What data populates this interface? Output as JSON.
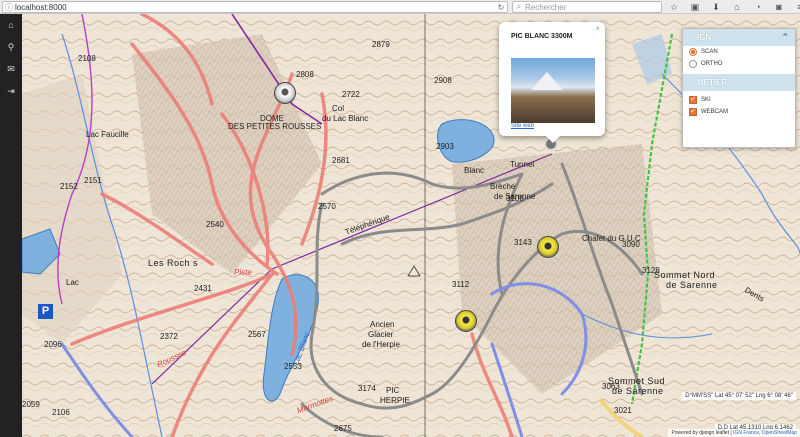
{
  "browser": {
    "url": "localhost:8000",
    "search_placeholder": "Rechercher"
  },
  "sidenav": {
    "items": [
      "home-icon",
      "search-icon",
      "mail-icon",
      "logout-icon"
    ]
  },
  "map_labels": {
    "dome": "DOME",
    "petites_rousses": "DES PETITES ROUSSES",
    "col_lac_blanc": "Col",
    "du_lac_blanc": "du Lac Blanc",
    "tunnel": "Tunnel",
    "breche": "Brèche",
    "de_sarenne": "de Sarenne",
    "chalet": "Chalet du G.U.C",
    "sommet_nord": "Sommet Nord",
    "de_sarenne_2": "de Sarenne",
    "sommet_sud": "Sommet Sud",
    "de_sarenne_3": "de Sarenne",
    "les_rochers": "Les Roch s",
    "lac_blanc": "Lac Blanc",
    "ancien": "Ancien",
    "glacier": "Glacier",
    "de_lhorpie": "de l'Herpie",
    "pic": "PIC",
    "herpie": "HERPIE",
    "teleph": "Téléphérique",
    "lac_faucille": "Lac Faucille",
    "rousses": "Rousses",
    "marmottes": "Marmottes",
    "blanc": "Blanc",
    "dents": "Dents",
    "piste": "Piste",
    "lac": "Lac",
    "e2808": "2808",
    "e2722": "2722",
    "e2879": "2879",
    "e2908": "2908",
    "e2903": "2903",
    "e2681": "2681",
    "e2570": "2570",
    "e3106": "3106",
    "e3143": "3143",
    "e3090": "3090",
    "e3128": "3128",
    "e2540": "2540",
    "e2431": "2431",
    "e2567": "2567",
    "e2372": "2372",
    "e2553": "2553",
    "e3063": "3063",
    "e2152": "2152",
    "e2106": "2106",
    "e2059": "2059",
    "e2096": "2096",
    "e2151": "2151",
    "e2108": "2108",
    "e3112": "3112",
    "e3174": "3174",
    "e2675": "2675",
    "e3021": "3021"
  },
  "popup": {
    "title": "PIC BLANC 3300M",
    "link": "Site web",
    "close": "×"
  },
  "layer_panel": {
    "ign_header": "IGN",
    "ign_options": [
      "SCAN",
      "ORTHO"
    ],
    "ign_selected": "SCAN",
    "metier_header": "METIER",
    "metier_options": [
      "SKI",
      "WEBCAM"
    ],
    "metier_checked": [
      "SKI",
      "WEBCAM"
    ]
  },
  "coords": {
    "dms": "D°MM'SS\" Lat 45° 07' 52\" Lng 6° 08' 46\"",
    "dd": "D.D Lat 45.1310 Lng 6.1462"
  },
  "attribution": {
    "text": "Powered by django leaflet",
    "ign": "IGN France",
    "osm": "OpenStreetMap"
  },
  "colors": {
    "accent": "#e0783b",
    "panel_header": "#cfe3ef",
    "piste_red": "#ea7a73",
    "trail_grey": "#8b8b8b",
    "lake_blue": "#5b9bd5"
  }
}
